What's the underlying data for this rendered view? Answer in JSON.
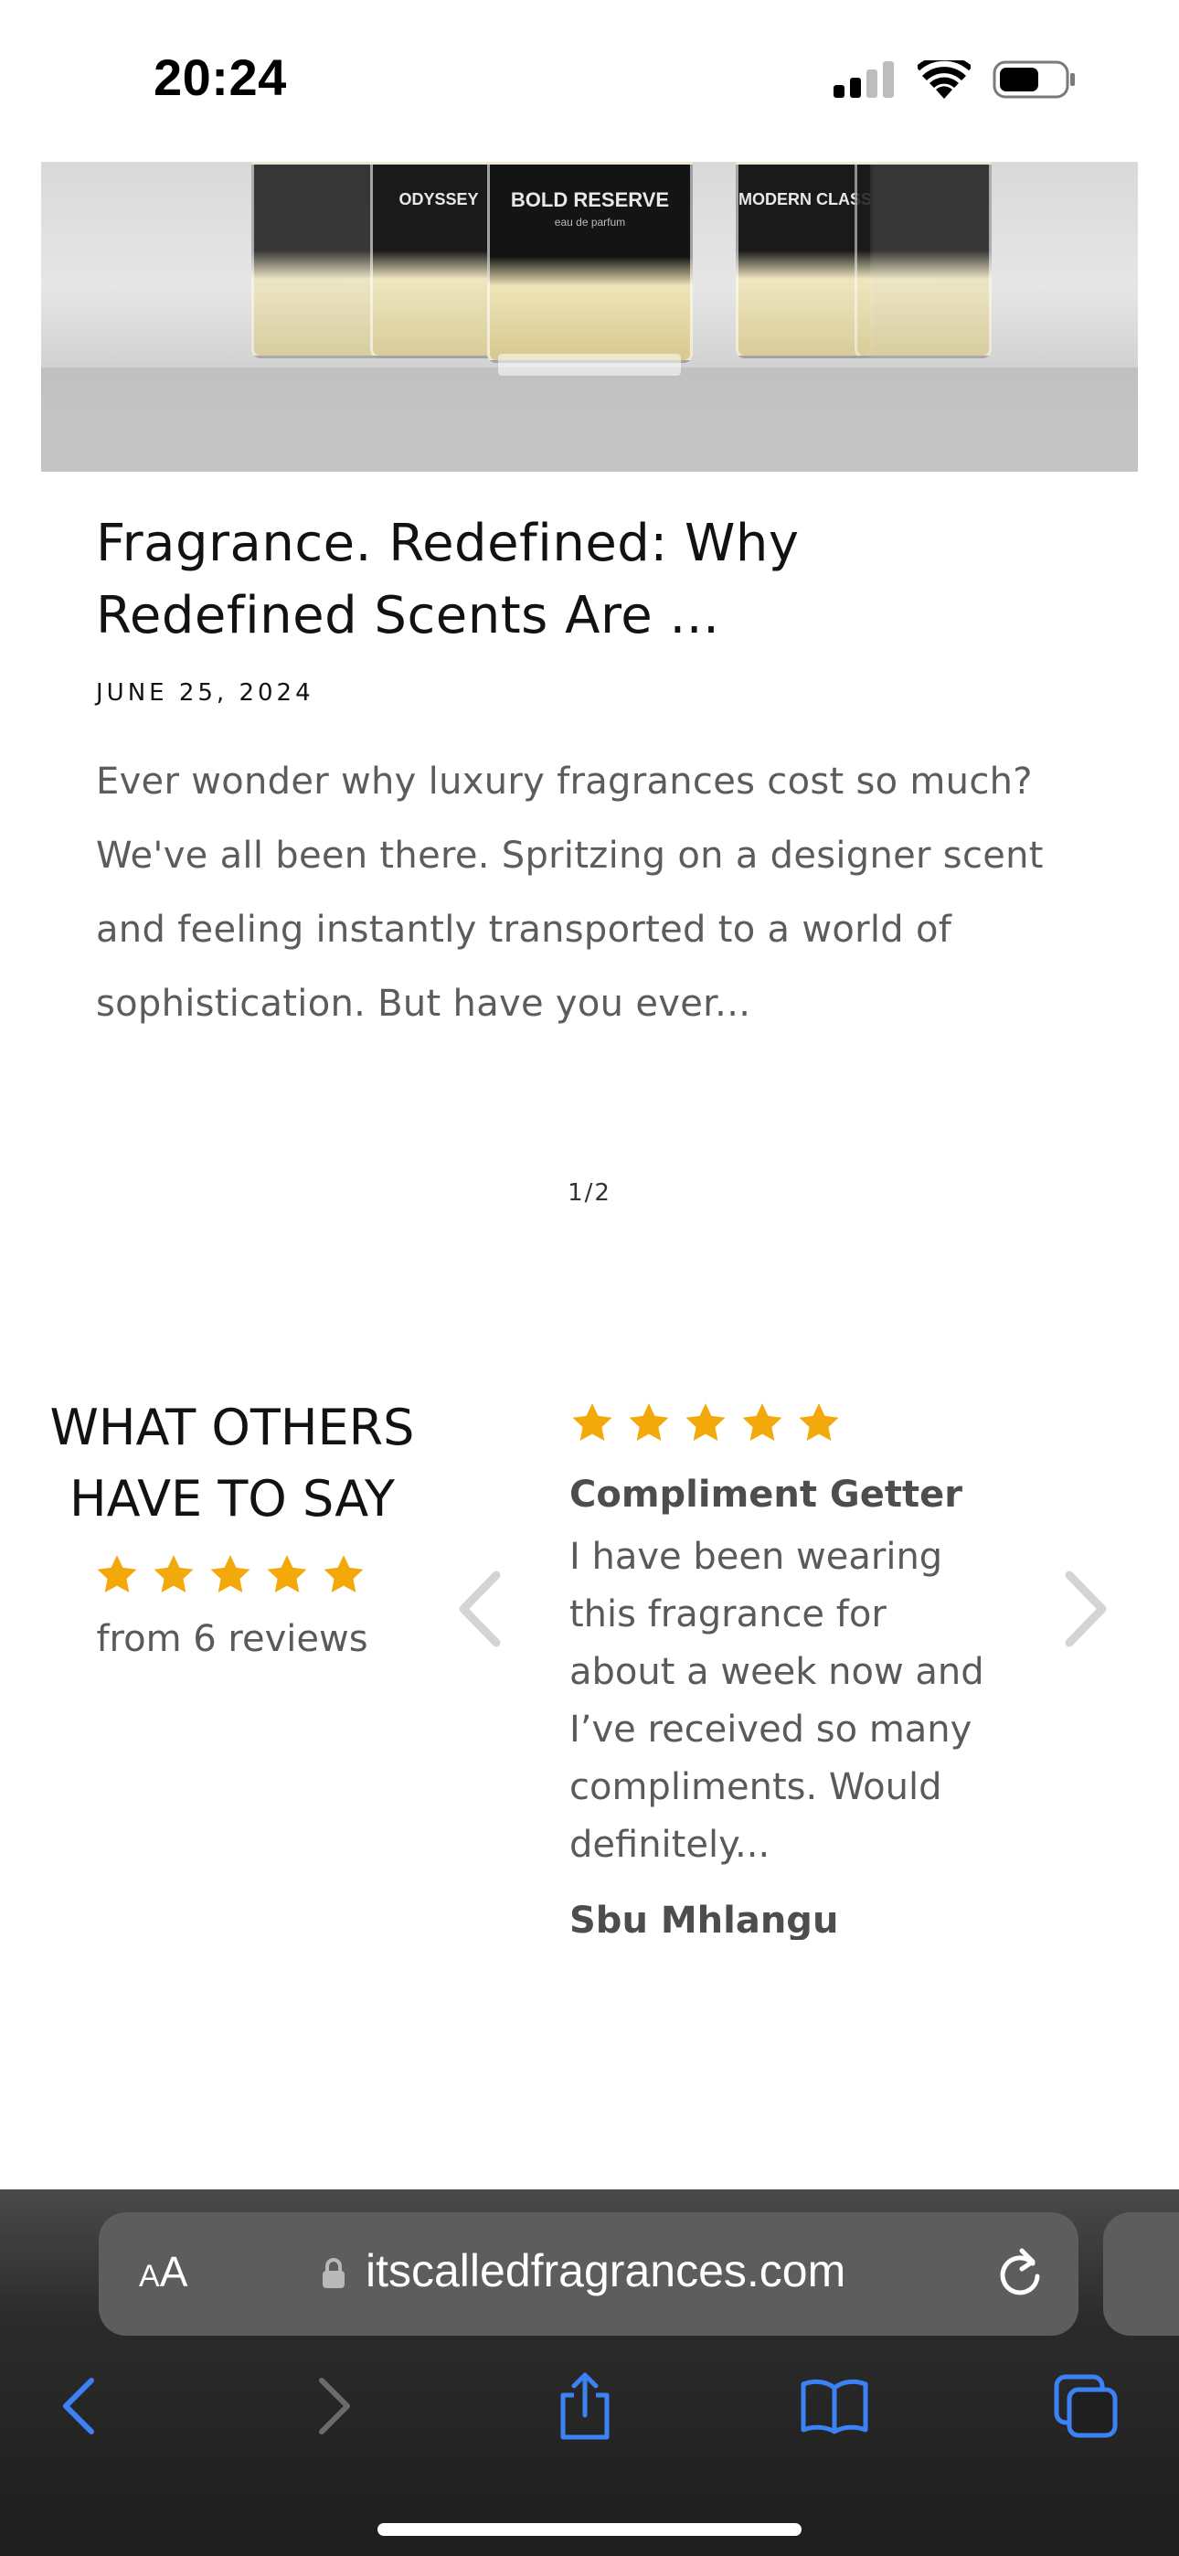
{
  "status_bar": {
    "time": "20:24",
    "icons": [
      "cellular-signal-icon",
      "wifi-icon",
      "battery-icon"
    ]
  },
  "hero": {
    "bottle_labels": [
      "ODYSSEY",
      "BOLD RESERVE",
      "MODERN CLASSIC"
    ],
    "center_sub": "eau de parfum"
  },
  "article": {
    "title": "Fragrance. Redefined: Why Redefined Scents Are ...",
    "date": "JUNE 25, 2024",
    "excerpt": "Ever wonder why luxury fragrances cost so much? We've all been there. Spritzing on a designer scent and feeling instantly transported to a world of sophistication. But have you ever..."
  },
  "pagination": "1/2",
  "reviews": {
    "heading": "WHAT OTHERS HAVE TO SAY",
    "summary_rating": 5,
    "summary_count": "from 6 reviews",
    "current": {
      "rating": 5,
      "title": "Compliment Getter",
      "body": "I have been wearing this fragrance for about a week now and I’ve received so many compliments. Would definitely...",
      "author": "Sbu Mhlangu"
    },
    "star_color": "#f3a90a"
  },
  "browser": {
    "aa_small": "A",
    "aa_big": "A",
    "url": "itscalledfragrances.com",
    "toolbar_icons": [
      "back-icon",
      "forward-icon",
      "share-icon",
      "bookmarks-icon",
      "tabs-icon"
    ],
    "accent": "#3b82f6"
  }
}
